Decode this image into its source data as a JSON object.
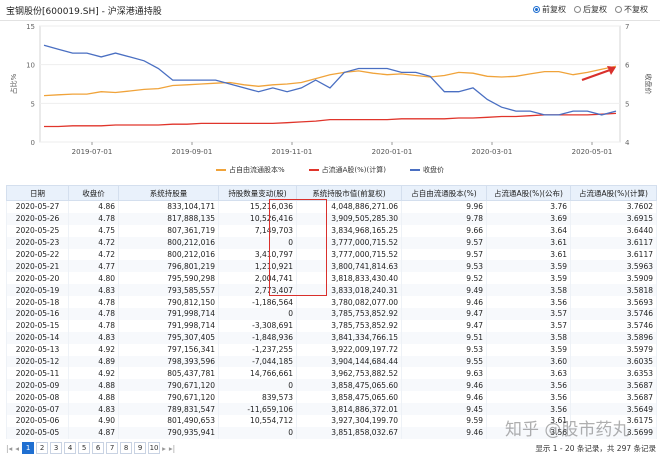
{
  "header": {
    "title": "宝钢股份[600019.SH] - 沪深港通持股",
    "options": [
      {
        "label": "前复权",
        "selected": true
      },
      {
        "label": "后复权",
        "selected": false
      },
      {
        "label": "不复权",
        "selected": false
      }
    ]
  },
  "chart_data": {
    "type": "line",
    "x_ticks": [
      "2019-07-01",
      "2019-09-01",
      "2019-11-01",
      "2020-01-01",
      "2020-03-01",
      "2020-05-01"
    ],
    "y_left_label": "占比%",
    "y_right_label": "收盘价",
    "y_left_ticks": [
      0,
      5,
      10,
      15
    ],
    "y_right_ticks": [
      4,
      5,
      6,
      7
    ],
    "ylim_left": [
      0,
      15
    ],
    "ylim_right": [
      4,
      7
    ],
    "series": [
      {
        "name": "占自由流通股本%",
        "color": "#f0a33a",
        "axis": "left",
        "values": [
          6.0,
          6.1,
          6.2,
          6.2,
          6.5,
          6.4,
          6.6,
          6.8,
          6.9,
          7.3,
          7.4,
          7.5,
          7.6,
          7.7,
          7.4,
          7.2,
          7.4,
          7.5,
          7.7,
          8.2,
          8.7,
          9.0,
          9.2,
          8.9,
          8.7,
          8.8,
          8.6,
          8.4,
          8.6,
          9.0,
          8.9,
          8.5,
          8.4,
          8.5,
          8.8,
          9.1,
          9.1,
          8.7,
          9.0,
          9.4,
          9.8
        ]
      },
      {
        "name": "占流通A股(%)(计算)",
        "color": "#e0352b",
        "axis": "left",
        "values": [
          2.0,
          2.0,
          2.1,
          2.1,
          2.1,
          2.2,
          2.2,
          2.2,
          2.2,
          2.3,
          2.3,
          2.4,
          2.4,
          2.4,
          2.4,
          2.4,
          2.4,
          2.5,
          2.6,
          2.7,
          2.9,
          2.9,
          2.9,
          2.9,
          2.9,
          3.0,
          3.0,
          3.0,
          3.0,
          3.1,
          3.1,
          3.2,
          3.3,
          3.3,
          3.4,
          3.5,
          3.5,
          3.5,
          3.5,
          3.6,
          3.7
        ]
      },
      {
        "name": "收盘价",
        "color": "#4a6fc2",
        "axis": "right",
        "values": [
          6.5,
          6.4,
          6.3,
          6.3,
          6.2,
          6.3,
          6.2,
          6.1,
          5.9,
          5.6,
          5.6,
          5.6,
          5.6,
          5.5,
          5.4,
          5.3,
          5.4,
          5.3,
          5.4,
          5.6,
          5.4,
          5.8,
          5.9,
          5.9,
          5.9,
          5.8,
          5.8,
          5.7,
          5.3,
          5.3,
          5.4,
          5.1,
          4.9,
          4.8,
          4.8,
          4.7,
          4.7,
          4.8,
          4.8,
          4.7,
          4.8
        ]
      }
    ],
    "legend": [
      "占自由流通股本%",
      "占流通A股(%)(计算)",
      "收盘价"
    ],
    "legend_position": "bottom"
  },
  "table": {
    "columns": [
      "日期",
      "收盘价",
      "系统持股量",
      "持股数量变动(股)",
      "系统持股市值(前复权)",
      "占自由流通股本(%)",
      "占流通A股(%)(公布)",
      "占流通A股(%)(计算)"
    ],
    "rows": [
      [
        "2020-05-27",
        "4.86",
        "833,104,171",
        "15,216,036",
        "4,048,886,271.06",
        "9.96",
        "3.76",
        "3.7602"
      ],
      [
        "2020-05-26",
        "4.78",
        "817,888,135",
        "10,526,416",
        "3,909,505,285.30",
        "9.78",
        "3.69",
        "3.6915"
      ],
      [
        "2020-05-25",
        "4.75",
        "807,361,719",
        "7,149,703",
        "3,834,968,165.25",
        "9.66",
        "3.64",
        "3.6440"
      ],
      [
        "2020-05-23",
        "4.72",
        "800,212,016",
        "0",
        "3,777,000,715.52",
        "9.57",
        "3.61",
        "3.6117"
      ],
      [
        "2020-05-22",
        "4.72",
        "800,212,016",
        "3,410,797",
        "3,777,000,715.52",
        "9.57",
        "3.61",
        "3.6117"
      ],
      [
        "2020-05-21",
        "4.77",
        "796,801,219",
        "1,210,921",
        "3,800,741,814.63",
        "9.53",
        "3.59",
        "3.5963"
      ],
      [
        "2020-05-20",
        "4.80",
        "795,590,298",
        "2,004,741",
        "3,818,833,430.40",
        "9.52",
        "3.59",
        "3.5909"
      ],
      [
        "2020-05-19",
        "4.83",
        "793,585,557",
        "2,773,407",
        "3,833,018,240.31",
        "9.49",
        "3.58",
        "3.5818"
      ],
      [
        "2020-05-18",
        "4.78",
        "790,812,150",
        "-1,186,564",
        "3,780,082,077.00",
        "9.46",
        "3.56",
        "3.5693"
      ],
      [
        "2020-05-16",
        "4.78",
        "791,998,714",
        "0",
        "3,785,753,852.92",
        "9.47",
        "3.57",
        "3.5746"
      ],
      [
        "2020-05-15",
        "4.78",
        "791,998,714",
        "-3,308,691",
        "3,785,753,852.92",
        "9.47",
        "3.57",
        "3.5746"
      ],
      [
        "2020-05-14",
        "4.83",
        "795,307,405",
        "-1,848,936",
        "3,841,334,766.15",
        "9.51",
        "3.58",
        "3.5896"
      ],
      [
        "2020-05-13",
        "4.92",
        "797,156,341",
        "-1,237,255",
        "3,922,009,197.72",
        "9.53",
        "3.59",
        "3.5979"
      ],
      [
        "2020-05-12",
        "4.89",
        "798,393,596",
        "-7,044,185",
        "3,904,144,684.44",
        "9.55",
        "3.60",
        "3.6035"
      ],
      [
        "2020-05-11",
        "4.92",
        "805,437,781",
        "14,766,661",
        "3,962,753,882.52",
        "9.63",
        "3.63",
        "3.6353"
      ],
      [
        "2020-05-09",
        "4.88",
        "790,671,120",
        "0",
        "3,858,475,065.60",
        "9.46",
        "3.56",
        "3.5687"
      ],
      [
        "2020-05-08",
        "4.88",
        "790,671,120",
        "839,573",
        "3,858,475,065.60",
        "9.46",
        "3.56",
        "3.5687"
      ],
      [
        "2020-05-07",
        "4.83",
        "789,831,547",
        "-11,659,106",
        "3,814,886,372.01",
        "9.45",
        "3.56",
        "3.5649"
      ],
      [
        "2020-05-06",
        "4.90",
        "801,490,653",
        "10,554,712",
        "3,927,304,199.70",
        "9.59",
        "3.61",
        "3.6175"
      ],
      [
        "2020-05-05",
        "4.87",
        "790,935,941",
        "0",
        "3,851,858,032.67",
        "9.46",
        "3.56",
        "3.5699"
      ]
    ]
  },
  "pagination": {
    "pages": [
      "1",
      "2",
      "3",
      "4",
      "5",
      "6",
      "7",
      "8",
      "9",
      "10"
    ],
    "current": "1",
    "info": "显示 1 - 20 条记录，共 297 条记录"
  },
  "watermark": "知乎 @股市药丸",
  "colors": {
    "accent": "#1f6fd1",
    "highlight_box": "#d9302c"
  }
}
